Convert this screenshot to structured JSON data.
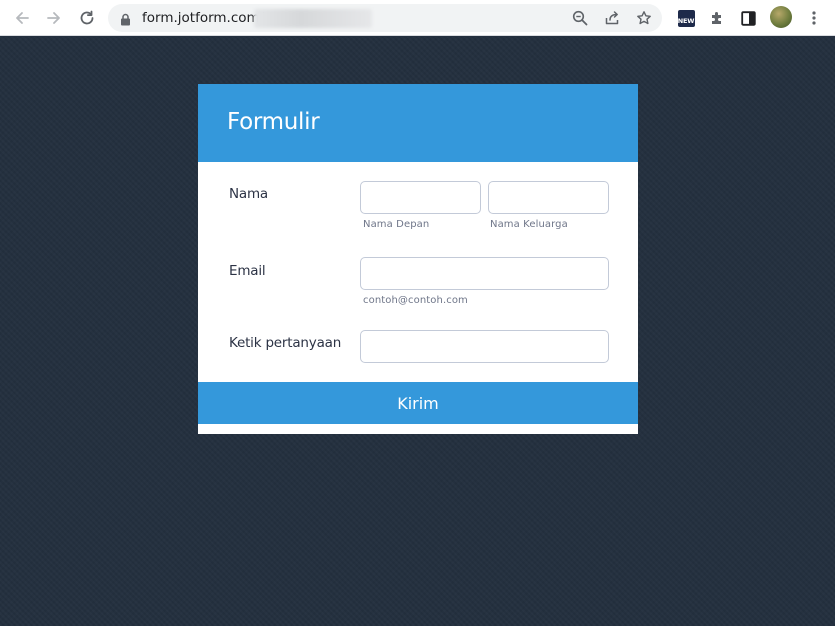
{
  "browser": {
    "url_visible": "form.jotform.com/",
    "extension_badge_text": "NEW"
  },
  "form": {
    "title": "Formulir",
    "fields": {
      "nama": {
        "label": "Nama",
        "first_sublabel": "Nama  Depan",
        "last_sublabel": "Nama  Keluarga",
        "first_value": "",
        "last_value": ""
      },
      "email": {
        "label": "Email",
        "sublabel": "contoh@contoh.com",
        "value": ""
      },
      "question": {
        "label": "Ketik pertanyaan",
        "value": ""
      }
    },
    "submit_label": "Kirim"
  },
  "colors": {
    "page_background": "#24303f",
    "header_blue": "#3498db",
    "button_blue": "#3498db",
    "card_background": "#ffffff",
    "label_text": "#2c3345"
  },
  "icons": [
    "back-arrow-icon",
    "forward-arrow-icon",
    "reload-icon",
    "lock-icon",
    "zoom-icon",
    "share-icon",
    "star-icon",
    "new-badge-icon",
    "puzzle-icon",
    "side-panel-icon",
    "avatar",
    "menu-dots-icon"
  ]
}
